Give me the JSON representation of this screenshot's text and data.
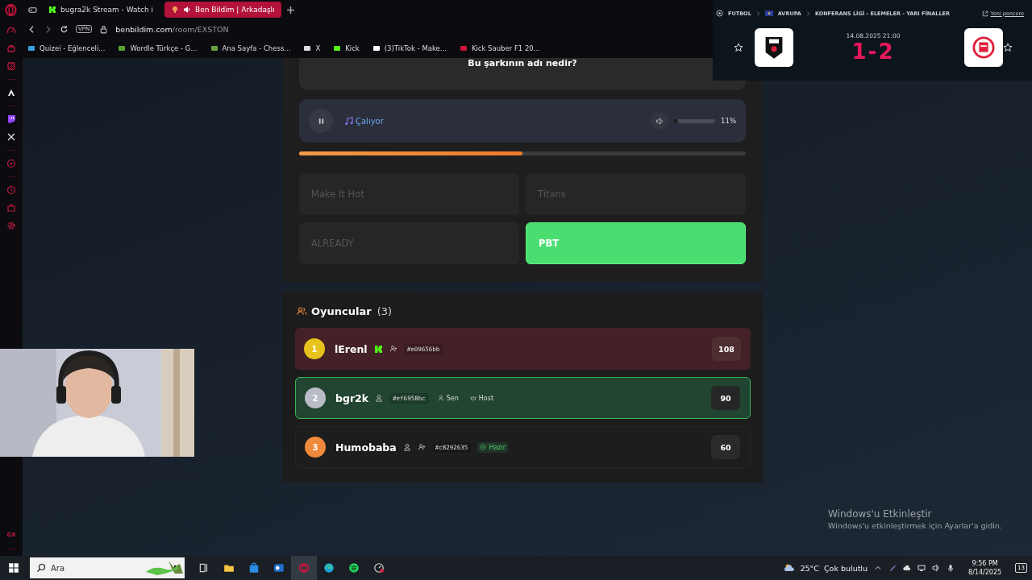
{
  "browser": {
    "tabs": [
      {
        "title": "bugra2k Stream - Watch i",
        "selected": false,
        "audio": false
      },
      {
        "title": "Ben Bildim | Arkadaşlı",
        "selected": true,
        "audio": true
      }
    ],
    "vpn": "VPN",
    "url": {
      "host": "benbildim.com",
      "path": "/room/EXSTON"
    },
    "bookmarks": [
      "Quizei - Eğlenceli...",
      "Wordle Türkçe - G...",
      "Ana Sayfa - Chess...",
      "X",
      "Kick",
      "(3)TikTok - Make...",
      "Kick Sauber F1 20..."
    ],
    "sidebar": {
      "footer_label": "GX",
      "more": "···"
    }
  },
  "question": "Bu şarkının adı nedir?",
  "player": {
    "playing": true,
    "status": "Çalıyor",
    "volume": {
      "level": 0.11,
      "reading": "11%"
    },
    "progress": {
      "level": 0.5
    }
  },
  "answers": [
    {
      "text": "Make It Hot",
      "selected": false
    },
    {
      "text": "Titans",
      "selected": false
    },
    {
      "text": "ALREADY",
      "selected": false
    },
    {
      "text": "PBT",
      "selected": true
    }
  ],
  "players": {
    "title": "Oyuncular",
    "count": "(3)",
    "items": [
      {
        "rank": "1",
        "color": "#e8c21c",
        "name": "lErenl",
        "kind": "opponent",
        "score": "108",
        "badges": [
          {
            "kind": "kick"
          },
          {
            "kind": "add_friend"
          },
          {
            "kind": "id",
            "text": "#e09656bb"
          }
        ]
      },
      {
        "rank": "2",
        "color": "#b9bcc4",
        "name": "bgr2k",
        "kind": "self",
        "score": "90",
        "badges": [
          {
            "kind": "user"
          },
          {
            "kind": "id",
            "text": "#ef6958bc"
          },
          {
            "kind": "you",
            "text": "Sen"
          },
          {
            "kind": "host",
            "text": "Host"
          }
        ]
      },
      {
        "rank": "3",
        "color": "#ef8a3c",
        "name": "Humobaba",
        "kind": "other",
        "score": "60",
        "badges": [
          {
            "kind": "user"
          },
          {
            "kind": "add_friend"
          },
          {
            "kind": "id",
            "text": "#c8292635"
          },
          {
            "kind": "ready",
            "text": "Hazır"
          }
        ]
      }
    ]
  },
  "match": {
    "breadcrumb": [
      "FUTBOL",
      "AVRUPA",
      "KONFERANS LİGİ - ELEMELER - YARI FİNALLER"
    ],
    "new_window": "Yeni pencere",
    "date": "14.08.2025 21:00",
    "score": "1-2"
  },
  "activation": {
    "title": "Windows'u Etkinleştir",
    "text": "Windows'u etkinleştirmek için Ayarlar'a gidin."
  },
  "taskbar": {
    "search_placeholder": "Ara",
    "weather": {
      "temperature": "25°C",
      "condition": "Çok bulutlu"
    },
    "time": "9:56 PM",
    "date": "8/14/2025",
    "notifications": "13"
  }
}
